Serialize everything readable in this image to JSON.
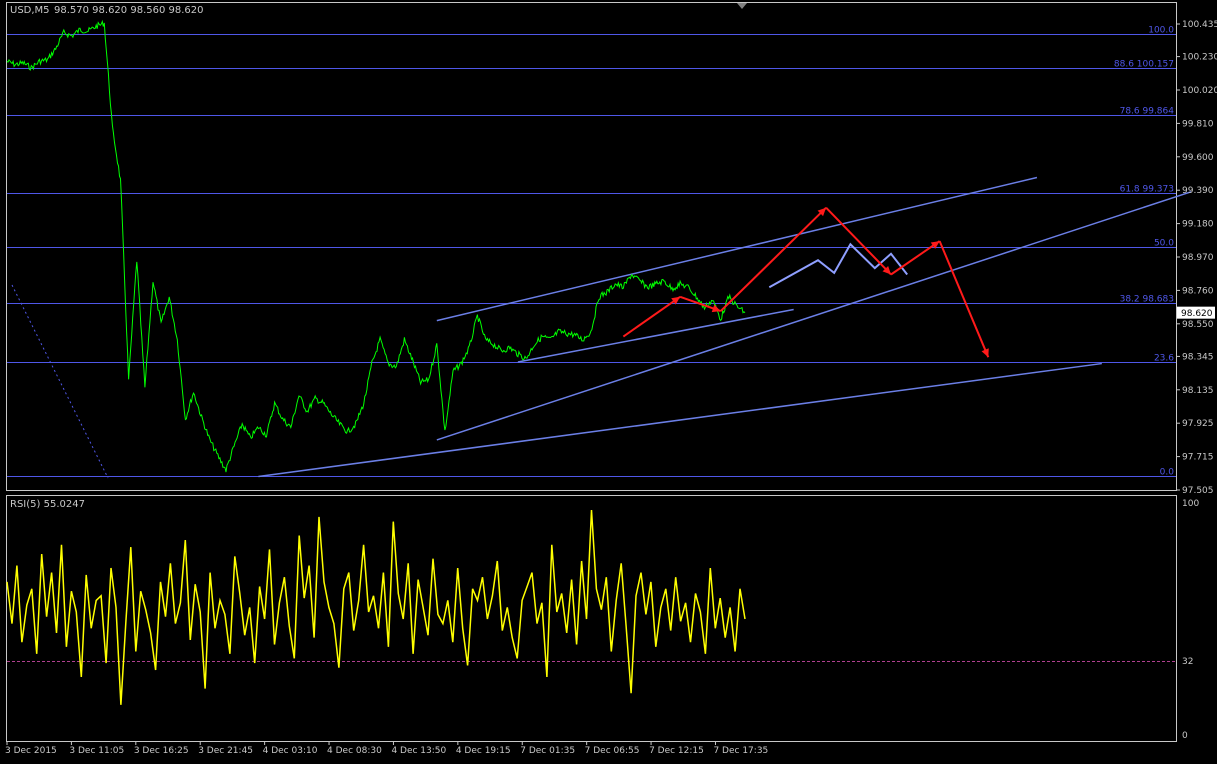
{
  "header": {
    "symbol_tf": "USD,M5",
    "ohlc": "98.570 98.620 98.560 98.620"
  },
  "colors": {
    "background": "#000000",
    "price_line": "#00ff00",
    "fib_line": "#4f57e8",
    "trend_line": "#6b7fe6",
    "projection_arrow": "#ff1a1a",
    "pattern_line": "#8f9fff",
    "rsi_line": "#ffff00",
    "rsi_level": "#b0408f",
    "frame": "#c8c8c8",
    "text": "#c8c8c8",
    "current_price_bg": "#ffffff"
  },
  "chart_data": [
    {
      "type": "line",
      "title": "USD,M5",
      "subtitle": "98.570 98.620 98.560 98.620",
      "xlabel": "",
      "ylabel": "",
      "ylim": [
        97.505,
        100.435
      ],
      "grid": false,
      "x_ticks": [
        "3 Dec 2015",
        "3 Dec 11:05",
        "3 Dec 16:25",
        "3 Dec 21:45",
        "4 Dec 03:10",
        "4 Dec 08:30",
        "4 Dec 13:50",
        "4 Dec 19:15",
        "7 Dec 01:35",
        "7 Dec 06:55",
        "7 Dec 12:15",
        "7 Dec 17:35"
      ],
      "y_ticks": [
        "100.435",
        "100.230",
        "100.020",
        "99.810",
        "99.600",
        "99.390",
        "99.180",
        "98.970",
        "98.760",
        "98.550",
        "98.345",
        "98.135",
        "97.925",
        "97.715",
        "97.505"
      ],
      "current_price": "98.620",
      "series": [
        {
          "values": [
            100.2,
            100.18,
            100.19,
            100.16,
            100.2,
            100.21,
            100.28,
            100.38,
            100.36,
            100.4,
            100.39,
            100.42,
            100.44,
            99.78,
            99.45,
            98.2,
            98.95,
            98.15,
            98.82,
            98.55,
            98.72,
            98.45,
            97.95,
            98.12,
            97.96,
            97.82,
            97.72,
            97.63,
            97.78,
            97.92,
            97.83,
            97.9,
            97.85,
            98.05,
            97.95,
            97.9,
            98.1,
            98.0,
            98.08,
            98.05,
            97.98,
            97.92,
            97.87,
            97.92,
            98.05,
            98.3,
            98.45,
            98.3,
            98.28,
            98.45,
            98.32,
            98.18,
            98.2,
            98.42,
            97.87,
            98.25,
            98.3,
            98.4,
            98.6,
            98.45,
            98.42,
            98.38,
            98.4,
            98.36,
            98.33,
            98.42,
            98.47,
            98.45,
            98.5,
            98.49,
            98.48,
            98.45,
            98.5,
            98.72,
            98.75,
            98.8,
            98.78,
            98.86,
            98.82,
            98.78,
            98.8,
            98.82,
            98.77,
            98.8,
            98.78,
            98.72,
            98.65,
            98.7,
            98.58,
            98.72,
            98.66,
            98.62
          ]
        }
      ],
      "fibonacci": {
        "levels": [
          {
            "label": "100.0",
            "price": 100.375
          },
          {
            "label": "88.6 100.157",
            "price": 100.157
          },
          {
            "label": "78.6 99.864",
            "price": 99.864
          },
          {
            "label": "61.8 99.373",
            "price": 99.373
          },
          {
            "label": "50.0",
            "price": 99.03
          },
          {
            "label": "38.2 98.683",
            "price": 98.683
          },
          {
            "label": "23.6",
            "price": 98.31
          },
          {
            "label": "0.0",
            "price": 97.59
          }
        ]
      },
      "trendlines": [
        {
          "from": [
            31,
            97.59
          ],
          "to": [
            135,
            98.3
          ]
        },
        {
          "from": [
            53,
            97.82
          ],
          "to": [
            146,
            99.38
          ]
        },
        {
          "from": [
            53,
            98.57
          ],
          "to": [
            127,
            99.47
          ]
        },
        {
          "from": [
            63,
            98.31
          ],
          "to": [
            97,
            98.64
          ]
        }
      ],
      "projection": [
        [
          76,
          98.47
        ],
        [
          83,
          98.72
        ],
        [
          88,
          98.63
        ],
        [
          101,
          99.28
        ],
        [
          109,
          98.86
        ],
        [
          115,
          99.07
        ],
        [
          121,
          98.34
        ]
      ],
      "pattern": [
        [
          94,
          98.78
        ],
        [
          100,
          98.95
        ],
        [
          102,
          98.87
        ],
        [
          104,
          99.05
        ],
        [
          107,
          98.9
        ],
        [
          109,
          98.99
        ],
        [
          111,
          98.86
        ]
      ]
    },
    {
      "type": "line",
      "title": "RSI(5) 55.0247",
      "ylim": [
        0,
        100
      ],
      "grid": false,
      "y_ticks": [
        "100",
        "32",
        "0"
      ],
      "levels": [
        32
      ],
      "series": [
        {
          "values": [
            66,
            48,
            73,
            40,
            56,
            63,
            35,
            78,
            51,
            70,
            44,
            82,
            38,
            62,
            53,
            25,
            69,
            46,
            58,
            60,
            31,
            72,
            55,
            13,
            49,
            81,
            36,
            62,
            54,
            44,
            28,
            66,
            51,
            74,
            48,
            57,
            84,
            41,
            65,
            53,
            20,
            70,
            46,
            58,
            52,
            35,
            77,
            61,
            43,
            55,
            31,
            64,
            50,
            80,
            39,
            57,
            68,
            47,
            33,
            86,
            59,
            73,
            42,
            94,
            66,
            55,
            48,
            29,
            63,
            70,
            45,
            58,
            82,
            53,
            60,
            46,
            70,
            38,
            92,
            61,
            50,
            74,
            35,
            67,
            55,
            43,
            76,
            52,
            48,
            58,
            40,
            72,
            46,
            30,
            63,
            58,
            68,
            50,
            60,
            75,
            45,
            55,
            42,
            33,
            58,
            64,
            70,
            48,
            57,
            25,
            82,
            53,
            61,
            44,
            67,
            39,
            75,
            50,
            97,
            63,
            54,
            68,
            36,
            58,
            74,
            47,
            18,
            60,
            70,
            52,
            66,
            38,
            55,
            63,
            45,
            68,
            49,
            57,
            40,
            61,
            53,
            35,
            72,
            46,
            59,
            42,
            55,
            36,
            63,
            50
          ]
        }
      ]
    }
  ]
}
